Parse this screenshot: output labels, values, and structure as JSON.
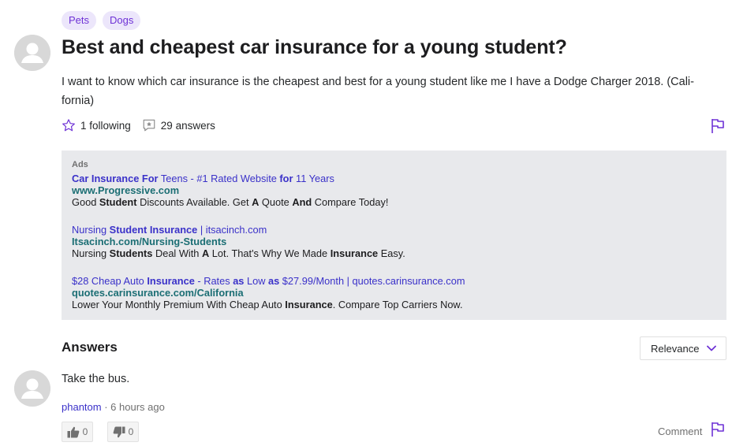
{
  "tags": [
    "Pets",
    "Dogs"
  ],
  "question": {
    "title": "Best and cheapest car insurance for a young student?",
    "body": "I want to know which car insurance is the cheapest and best for a young student like me I have a Dodge Charger 2018. (Cali-fornia)",
    "following": "1 following",
    "answers_count": "29 answers"
  },
  "ads": {
    "label": "Ads",
    "items": [
      {
        "title_parts": [
          {
            "text": "Car Insurance For",
            "bold": true
          },
          {
            "text": " Teens - #1 Rated Website ",
            "bold": false
          },
          {
            "text": "for",
            "bold": true
          },
          {
            "text": " 11 Years",
            "bold": false
          }
        ],
        "url": "www.Progressive.com",
        "desc_parts": [
          {
            "text": "Good ",
            "bold": false
          },
          {
            "text": "Student",
            "bold": true
          },
          {
            "text": " Discounts Available. Get ",
            "bold": false
          },
          {
            "text": "A",
            "bold": true
          },
          {
            "text": " Quote ",
            "bold": false
          },
          {
            "text": "And",
            "bold": true
          },
          {
            "text": " Compare Today!",
            "bold": false
          }
        ]
      },
      {
        "title_parts": [
          {
            "text": "Nursing ",
            "bold": false
          },
          {
            "text": "Student Insurance",
            "bold": true
          },
          {
            "text": " | itsacinch.com",
            "bold": false
          }
        ],
        "url": "Itsacinch.com/Nursing-Students",
        "desc_parts": [
          {
            "text": "Nursing ",
            "bold": false
          },
          {
            "text": "Students",
            "bold": true
          },
          {
            "text": " Deal With ",
            "bold": false
          },
          {
            "text": "A",
            "bold": true
          },
          {
            "text": " Lot. That's Why We Made ",
            "bold": false
          },
          {
            "text": "Insurance",
            "bold": true
          },
          {
            "text": " Easy.",
            "bold": false
          }
        ]
      },
      {
        "title_parts": [
          {
            "text": "$28 Cheap Auto ",
            "bold": false
          },
          {
            "text": "Insurance",
            "bold": true
          },
          {
            "text": " - Rates ",
            "bold": false
          },
          {
            "text": "as",
            "bold": true
          },
          {
            "text": " Low ",
            "bold": false
          },
          {
            "text": "as",
            "bold": true
          },
          {
            "text": " $27.99/Month | quotes.carinsurance.com",
            "bold": false
          }
        ],
        "url": "quotes.carinsurance.com/California",
        "desc_parts": [
          {
            "text": "Lower Your Monthly Premium With Cheap Auto ",
            "bold": false
          },
          {
            "text": "Insurance",
            "bold": true
          },
          {
            "text": ". Compare Top Carriers Now.",
            "bold": false
          }
        ]
      }
    ]
  },
  "answers_section": {
    "heading": "Answers",
    "sort_label": "Relevance"
  },
  "answer": {
    "text": "Take the bus.",
    "author": "phantom",
    "separator": " · ",
    "time": "6 hours ago",
    "upvotes": "0",
    "downvotes": "0",
    "comment_label": "Comment"
  },
  "colors": {
    "accent": "#6e32d6",
    "link": "#3a31c9",
    "ad_url": "#1b6e74",
    "ads_bg": "#e8e9ec"
  },
  "icons": [
    "user-avatar-icon",
    "star-outline-icon",
    "answers-star-icon",
    "flag-icon",
    "chevron-down-icon",
    "thumbs-up-icon",
    "thumbs-down-icon"
  ]
}
